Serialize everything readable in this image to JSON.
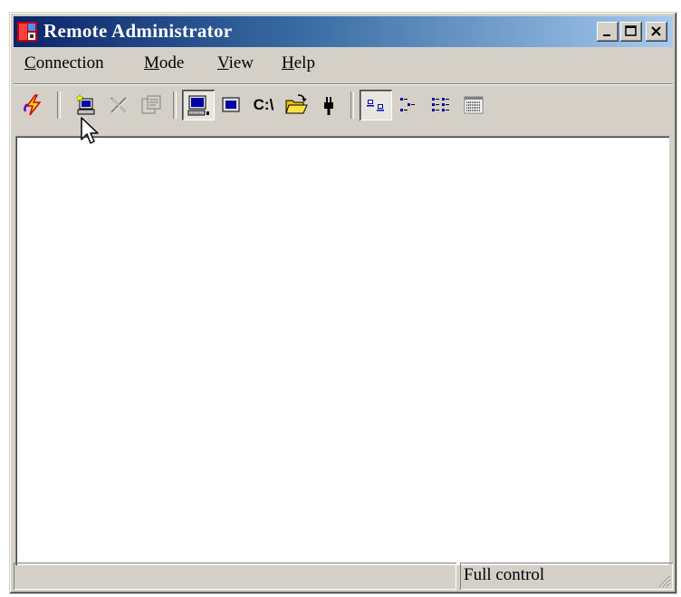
{
  "window": {
    "title": "Remote Administrator",
    "controls": [
      "minimize",
      "maximize",
      "close"
    ]
  },
  "menu": {
    "items": [
      {
        "label": "Connection",
        "accel": "C",
        "rest": "onnection"
      },
      {
        "label": "Mode",
        "accel": "M",
        "rest": "ode"
      },
      {
        "label": "View",
        "accel": "V",
        "rest": "iew"
      },
      {
        "label": "Help",
        "accel": "H",
        "rest": "elp"
      }
    ]
  },
  "toolbar": {
    "buttons": [
      {
        "name": "connect-icon",
        "state": "enabled"
      },
      {
        "name": "add-connection-icon",
        "state": "enabled"
      },
      {
        "name": "delete-icon",
        "state": "disabled"
      },
      {
        "name": "properties-icon",
        "state": "disabled"
      },
      {
        "name": "full-control-icon",
        "state": "pressed"
      },
      {
        "name": "view-only-icon",
        "state": "enabled"
      },
      {
        "name": "telnet-icon",
        "state": "enabled",
        "label": "C:\\"
      },
      {
        "name": "file-transfer-icon",
        "state": "enabled"
      },
      {
        "name": "shutdown-icon",
        "state": "enabled"
      },
      {
        "name": "large-icons-view-icon",
        "state": "pressed"
      },
      {
        "name": "small-icons-view-icon",
        "state": "enabled"
      },
      {
        "name": "list-view-icon",
        "state": "enabled"
      },
      {
        "name": "details-view-icon",
        "state": "enabled"
      }
    ]
  },
  "status": {
    "left": "",
    "right": "Full control"
  },
  "colors": {
    "titlebar_start": "#0a246a",
    "titlebar_end": "#a6caf0",
    "face": "#d4d0c8"
  }
}
